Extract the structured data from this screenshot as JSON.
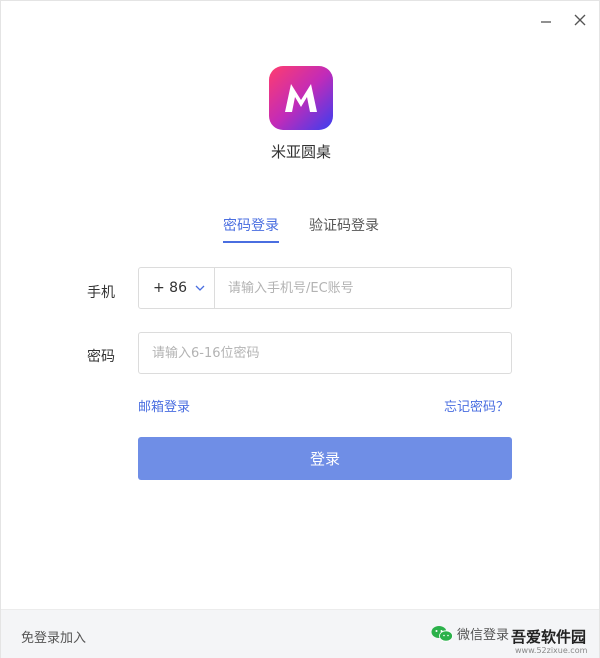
{
  "app": {
    "name": "米亚圆桌"
  },
  "window_controls": {
    "minimize_icon": "minimize-icon",
    "close_icon": "close-icon"
  },
  "tabs": [
    {
      "label": "密码登录",
      "active": true
    },
    {
      "label": "验证码登录",
      "active": false
    }
  ],
  "form": {
    "phone_label": "手机",
    "country_code": "+ 86",
    "phone_placeholder": "请输入手机号/EC账号",
    "password_label": "密码",
    "password_placeholder": "请输入6-16位密码"
  },
  "links": {
    "email_login": "邮箱登录",
    "forgot_password": "忘记密码？"
  },
  "login_button": "登录",
  "footer": {
    "free_login": "免登录加入",
    "wechat_login": "微信登录",
    "wechat_icon": "wechat-icon"
  },
  "watermark": {
    "text": "吾爱软件园",
    "url": "www.52zixue.com"
  },
  "colors": {
    "accent": "#4a6ee0",
    "button": "#6f8ee6",
    "footer_bg": "#f4f5f7"
  }
}
